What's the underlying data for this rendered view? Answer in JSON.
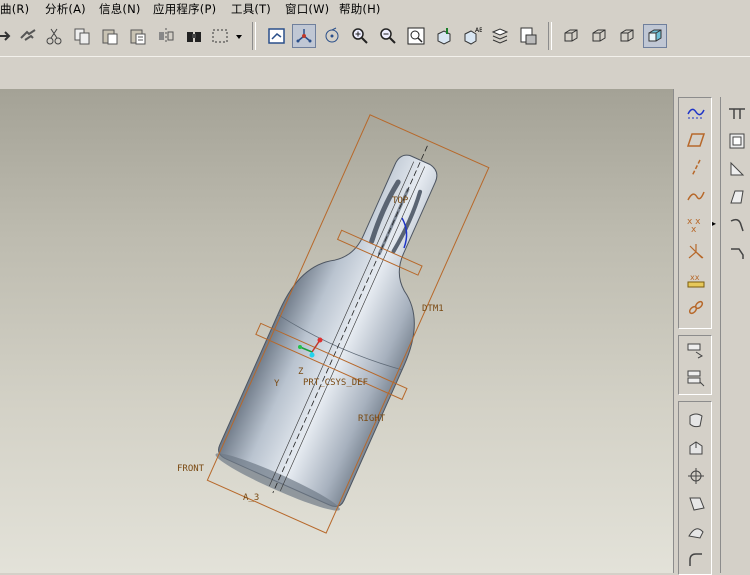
{
  "menu": {
    "items": [
      "曲面(R)",
      "分析(A)",
      "信息(N)",
      "应用程序(P)",
      "工具(T)",
      "窗口(W)",
      "帮助(H)"
    ],
    "visible": [
      "曲(R)",
      "分析(A)",
      "信息(N)",
      "应用程序(P)",
      "工具(T)",
      "窗口(W)",
      "帮助(H)"
    ]
  },
  "toolbar": {
    "icons": [
      "redo-icon",
      "regenerate-icon",
      "cut-icon",
      "copy-icon",
      "paste-icon",
      "paste-special-icon",
      "mirror-icon",
      "find-icon",
      "selection-box-icon",
      "repaint-icon",
      "spin-center-icon",
      "orient-mode-icon",
      "zoom-in-icon",
      "zoom-out-icon",
      "refit-icon",
      "reorient-icon",
      "saved-views-icon",
      "layers-icon",
      "view-manager-icon",
      "wireframe-icon",
      "hidden-line-icon",
      "no-hidden-icon",
      "shading-icon"
    ]
  },
  "viewport": {
    "datum_labels": {
      "top": "TOP",
      "dtm1": "DTM1",
      "csys": "PRT_CSYS_DEF",
      "right": "RIGHT",
      "front": "FRONT",
      "axis": "A_3"
    },
    "colors": {
      "datum": "#b7682a",
      "model_light": "#d5dce6",
      "model_dark": "#8c97a5",
      "edge": "#2a2a2a"
    }
  },
  "rightbar": {
    "datum_tools": [
      "sketch-tool-icon",
      "datum-plane-icon",
      "datum-axis-icon",
      "datum-curve-icon",
      "datum-point-icon",
      "datum-csys-icon",
      "analysis-feature-icon",
      "chain-icon"
    ],
    "edit_tools": [
      "mirror-tool-icon",
      "merge-tool-icon"
    ],
    "feature_tools": [
      "trim-icon",
      "offset-icon",
      "thicken-icon",
      "solidify-icon",
      "warp-icon",
      "round-icon"
    ],
    "side_tools": [
      "hole-icon",
      "shell-icon",
      "rib-icon",
      "draft-icon",
      "round-edge-icon",
      "chamfer-icon"
    ]
  }
}
